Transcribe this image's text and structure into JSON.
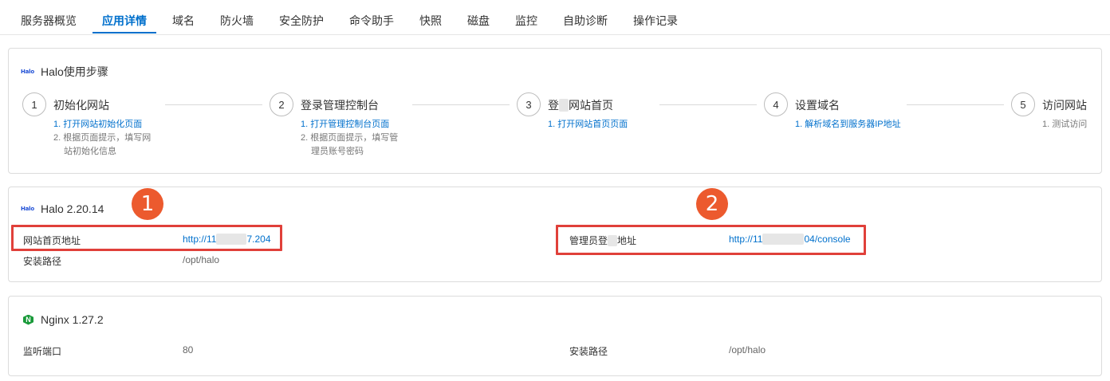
{
  "tabs": [
    {
      "label": "服务器概览"
    },
    {
      "label": "应用详情"
    },
    {
      "label": "域名"
    },
    {
      "label": "防火墙"
    },
    {
      "label": "安全防护"
    },
    {
      "label": "命令助手"
    },
    {
      "label": "快照"
    },
    {
      "label": "磁盘"
    },
    {
      "label": "监控"
    },
    {
      "label": "自助诊断"
    },
    {
      "label": "操作记录"
    }
  ],
  "active_tab": "应用详情",
  "steps_card": {
    "logo": "Halo",
    "title": "Halo使用步骤",
    "steps": [
      {
        "num": "1",
        "title": "初始化网站",
        "link": "1. 打开网站初始化页面",
        "extra1": "2. 根据页面提示，填写网",
        "extra2": "站初始化信息"
      },
      {
        "num": "2",
        "title": "登录管理控制台",
        "link": "1. 打开管理控制台页面",
        "extra1": "2. 根据页面提示，填写管",
        "extra2": "理员账号密码"
      },
      {
        "num": "3",
        "title_a": "登",
        "title_b": "网站首页",
        "link": "1. 打开网站首页页面"
      },
      {
        "num": "4",
        "title": "设置域名",
        "link": "1. 解析域名到服务器IP地址"
      },
      {
        "num": "5",
        "title": "访问网站",
        "text": "1. 测试访问"
      }
    ]
  },
  "halo_card": {
    "logo": "Halo",
    "title": "Halo 2.20.14",
    "homepage_label": "网站首页地址",
    "homepage_url_a": "http://11",
    "homepage_url_b": "7.204",
    "admin_label_a": "管理员登",
    "admin_label_b": "地址",
    "admin_url_a": "http://11",
    "admin_url_b": "04/console",
    "install_label": "安装路径",
    "install_value": "/opt/halo",
    "badge1": "1",
    "badge2": "2"
  },
  "nginx_card": {
    "logo": "N",
    "title": "Nginx 1.27.2",
    "port_label": "监听端口",
    "port_value": "80",
    "install_label": "安装路径",
    "install_value": "/opt/halo"
  },
  "colors": {
    "accent": "#0070cc",
    "highlight_box": "#e0403a",
    "badge": "#ec5a2e",
    "nginx_green": "#1a9a3a"
  }
}
